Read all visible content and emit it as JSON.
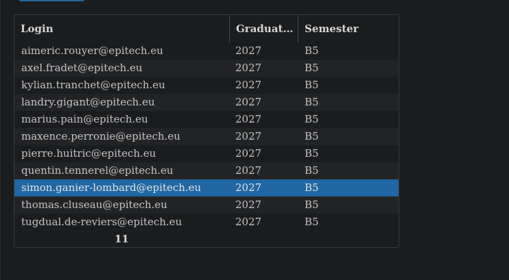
{
  "table": {
    "columns": [
      "Login",
      "Graduat…",
      "Semester"
    ],
    "rows": [
      {
        "login": "aimeric.rouyer@epitech.eu",
        "graduation": "2027",
        "semester": "B5"
      },
      {
        "login": "axel.fradet@epitech.eu",
        "graduation": "2027",
        "semester": "B5"
      },
      {
        "login": "kylian.tranchet@epitech.eu",
        "graduation": "2027",
        "semester": "B5"
      },
      {
        "login": "landry.gigant@epitech.eu",
        "graduation": "2027",
        "semester": "B5"
      },
      {
        "login": "marius.pain@epitech.eu",
        "graduation": "2027",
        "semester": "B5"
      },
      {
        "login": "maxence.perronie@epitech.eu",
        "graduation": "2027",
        "semester": "B5"
      },
      {
        "login": "pierre.huitric@epitech.eu",
        "graduation": "2027",
        "semester": "B5"
      },
      {
        "login": "quentin.tennerel@epitech.eu",
        "graduation": "2027",
        "semester": "B5"
      },
      {
        "login": "simon.ganier-lombard@epitech.eu",
        "graduation": "2027",
        "semester": "B5"
      },
      {
        "login": "thomas.cluseau@epitech.eu",
        "graduation": "2027",
        "semester": "B5"
      },
      {
        "login": "tugdual.de-reviers@epitech.eu",
        "graduation": "2027",
        "semester": "B5"
      }
    ],
    "selected_index": 8,
    "footer_count": "11"
  },
  "colors": {
    "background": "#1b1c1e",
    "accent": "#1f66a3"
  }
}
